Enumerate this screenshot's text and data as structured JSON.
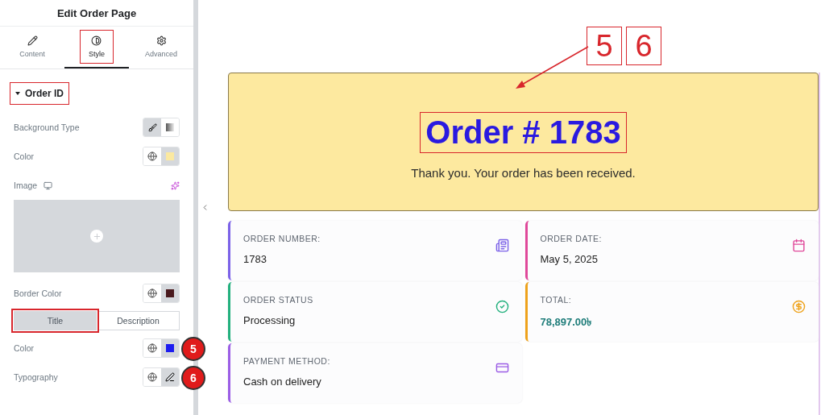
{
  "panel": {
    "title": "Edit Order Page",
    "tabs": [
      {
        "label": "Content",
        "selected": false,
        "highlighted": false
      },
      {
        "label": "Style",
        "selected": true,
        "highlighted": true
      },
      {
        "label": "Advanced",
        "selected": false,
        "highlighted": false
      }
    ],
    "section": {
      "title": "Order ID",
      "expanded": true,
      "highlighted": true
    },
    "controls": [
      {
        "kind": "toggle",
        "label": "Background Type",
        "options": [
          {
            "selected": true
          },
          {
            "selected": false
          }
        ]
      },
      {
        "kind": "color",
        "label": "Color",
        "color": "#fbe9a0"
      },
      {
        "kind": "image",
        "label": "Image"
      },
      {
        "kind": "color",
        "label": "Border Color",
        "color": "#4a1a1e"
      },
      {
        "kind": "switch",
        "options": [
          {
            "label": "Title",
            "selected": true,
            "highlighted": true
          },
          {
            "label": "Description",
            "selected": false,
            "highlighted": false
          }
        ]
      },
      {
        "kind": "color",
        "label": "Color",
        "color": "#1c1cf0",
        "badge": "5"
      },
      {
        "kind": "typography",
        "label": "Typography",
        "badge": "6"
      }
    ]
  },
  "preview": {
    "callouts": [
      "5",
      "6"
    ],
    "header": {
      "title": "Order # 1783",
      "subtitle": "Thank you. Your order has been received.",
      "highlighted": true
    },
    "cards": [
      {
        "label": "ORDER NUMBER:",
        "value": "1783",
        "color": "#7b61e8",
        "kind": "text"
      },
      {
        "label": "ORDER DATE:",
        "value": "May 5, 2025",
        "color": "#e0489a",
        "kind": "text"
      },
      {
        "label": "ORDER STATUS",
        "value": "Processing",
        "color": "#22b07d",
        "kind": "text"
      },
      {
        "label": "TOTAL:",
        "value": "78,897.00৳",
        "color": "#eea21b",
        "kind": "amount"
      },
      {
        "label": "PAYMENT METHOD:",
        "value": "Cash on delivery",
        "color": "#9b5de5",
        "kind": "text"
      }
    ]
  }
}
